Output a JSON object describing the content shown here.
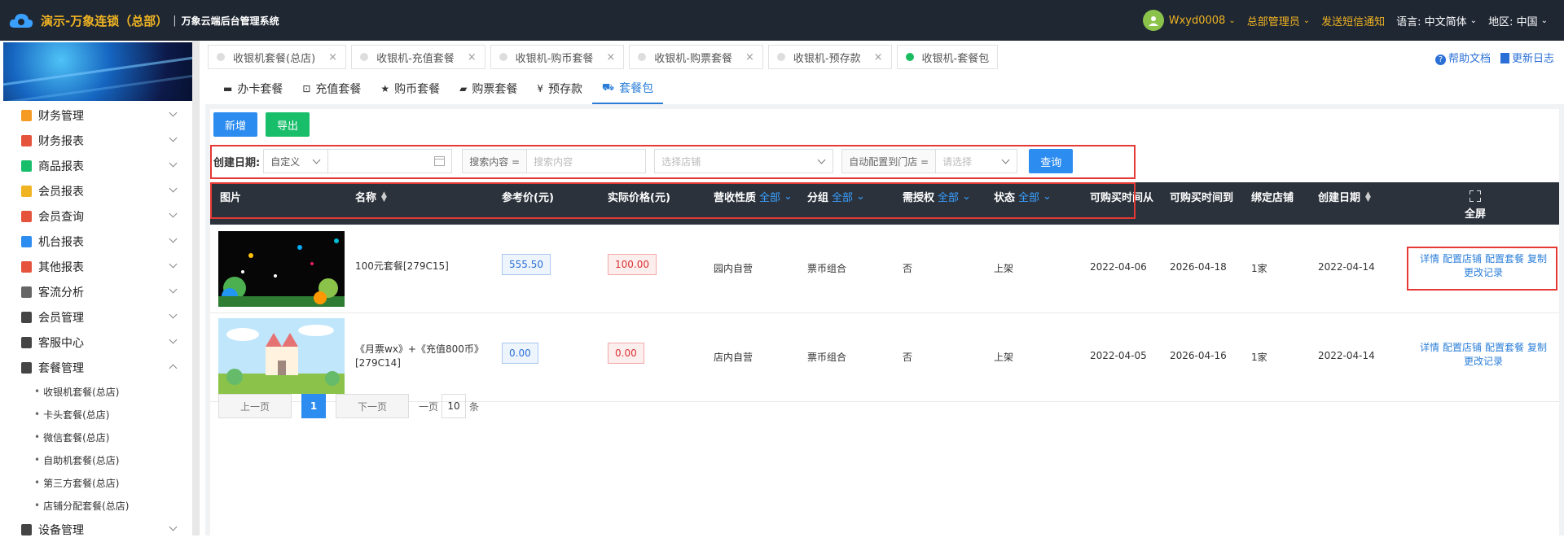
{
  "topbar": {
    "brand": "演示-万象连锁（总部）",
    "system": "万象云端后台管理系统",
    "user": "Wxyd0008",
    "role": "总部管理员",
    "sms": "发送短信通知",
    "lang_label": "语言:",
    "lang_value": "中文简体",
    "region_label": "地区:",
    "region_value": "中国"
  },
  "sidebar": {
    "items": [
      {
        "label": "财务管理",
        "color": "#f59a23"
      },
      {
        "label": "财务报表",
        "color": "#e5533d"
      },
      {
        "label": "商品报表",
        "color": "#19be6b"
      },
      {
        "label": "会员报表",
        "color": "#f0b322"
      },
      {
        "label": "会员查询",
        "color": "#e5533d"
      },
      {
        "label": "机台报表",
        "color": "#2d8cf0"
      },
      {
        "label": "其他报表",
        "color": "#e5533d"
      },
      {
        "label": "客流分析",
        "color": "#666666"
      },
      {
        "label": "会员管理",
        "color": "#444444"
      },
      {
        "label": "客服中心",
        "color": "#444444"
      },
      {
        "label": "套餐管理",
        "color": "#444444"
      }
    ],
    "subitems": [
      "收银机套餐(总店)",
      "卡头套餐(总店)",
      "微信套餐(总店)",
      "自助机套餐(总店)",
      "第三方套餐(总店)",
      "店铺分配套餐(总店)"
    ],
    "last_item": "设备管理"
  },
  "page_tabs": [
    "收银机套餐(总店)",
    "收银机-充值套餐",
    "收银机-购币套餐",
    "收银机-购票套餐",
    "收银机-预存款",
    "收银机-套餐包"
  ],
  "help": "帮助文档",
  "changelog": "更新日志",
  "subtabs": [
    {
      "icon": "▬",
      "label": "办卡套餐"
    },
    {
      "icon": "⊡",
      "label": "充值套餐"
    },
    {
      "icon": "★",
      "label": "购币套餐"
    },
    {
      "icon": "▰",
      "label": "购票套餐"
    },
    {
      "icon": "¥",
      "label": "预存款"
    },
    {
      "icon": "⛟",
      "label": "套餐包"
    }
  ],
  "buttons": {
    "add": "新增",
    "export": "导出",
    "query": "查询"
  },
  "filters": {
    "date_label": "创建日期:",
    "date_mode": "自定义",
    "search_prefix": "搜索内容 =",
    "search_placeholder": "搜索内容",
    "store_placeholder": "选择店铺",
    "auto_prefix": "自动配置到门店 =",
    "auto_placeholder": "请选择"
  },
  "table": {
    "headers": {
      "image": "图片",
      "name": "名称",
      "ref_price": "参考价(元)",
      "actual_price": "实际价格(元)",
      "revenue_type": "营收性质",
      "group": "分组",
      "auth": "需授权",
      "status": "状态",
      "buy_from": "可购买时间从",
      "buy_to": "可购买时间到",
      "bound_store": "绑定店铺",
      "created": "创建日期",
      "all": "全部",
      "fullscreen": "全屏"
    },
    "rows": [
      {
        "name": "100元套餐[279C15]",
        "ref_price": "555.50",
        "actual_price": "100.00",
        "revenue_type": "园内自营",
        "group": "票币组合",
        "auth": "否",
        "status": "上架",
        "buy_from": "2022-04-06",
        "buy_to": "2026-04-18",
        "bound_store": "1家",
        "created": "2022-04-14"
      },
      {
        "name_line1": "《月票wx》+《充值800币》",
        "name_line2": "[279C14]",
        "ref_price": "0.00",
        "actual_price": "0.00",
        "revenue_type": "店内自营",
        "group": "票币组合",
        "auth": "否",
        "status": "上架",
        "buy_from": "2022-04-05",
        "buy_to": "2026-04-16",
        "bound_store": "1家",
        "created": "2022-04-14"
      }
    ],
    "ops": {
      "detail": "详情",
      "config_store": "配置店铺",
      "config_pkg": "配置套餐",
      "copy": "复制",
      "history": "更改记录"
    }
  },
  "pager": {
    "prev": "上一页",
    "page": "1",
    "next": "下一页",
    "per_label": "一页",
    "per_value": "10",
    "unit": "条"
  }
}
